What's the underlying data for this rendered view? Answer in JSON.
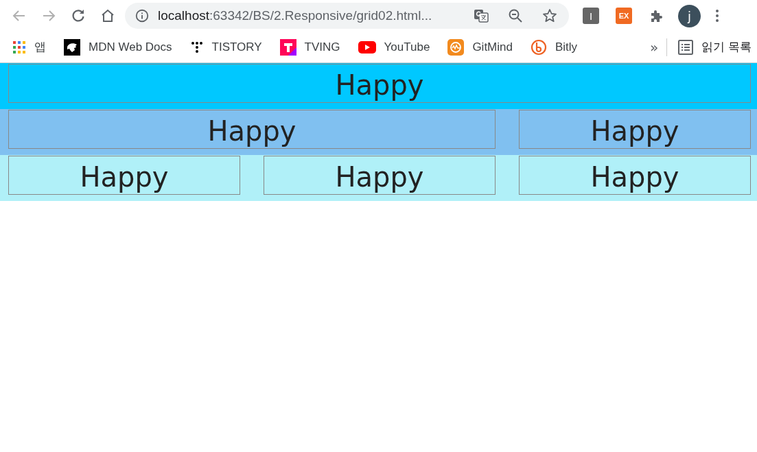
{
  "toolbar": {
    "back_disabled": true,
    "forward_disabled": true,
    "url": {
      "host": "localhost",
      "path": ":63342/BS/2.Responsive/grid02.html..."
    },
    "extensions": [
      {
        "kind": "letter",
        "label": "I"
      },
      {
        "kind": "ex",
        "label": "EX"
      }
    ],
    "avatar": "j"
  },
  "bookmarks": {
    "items": [
      {
        "kind": "apps",
        "label": "앱"
      },
      {
        "kind": "mdn",
        "label": "MDN Web Docs"
      },
      {
        "kind": "tistory",
        "label": "TISTORY"
      },
      {
        "kind": "tving",
        "label": "TVING"
      },
      {
        "kind": "youtube",
        "label": "YouTube"
      },
      {
        "kind": "gitmind",
        "label": "GitMind"
      },
      {
        "kind": "bitly",
        "label": "Bitly"
      }
    ],
    "more": "»",
    "reading_list": "읽기 목록"
  },
  "rows": [
    {
      "color": "#00c8ff",
      "cells": [
        "Happy"
      ]
    },
    {
      "color": "#80c0f0",
      "cells": [
        "Happy",
        "Happy"
      ]
    },
    {
      "color": "#b0f0f8",
      "cells": [
        "Happy",
        "Happy",
        "Happy"
      ]
    }
  ]
}
